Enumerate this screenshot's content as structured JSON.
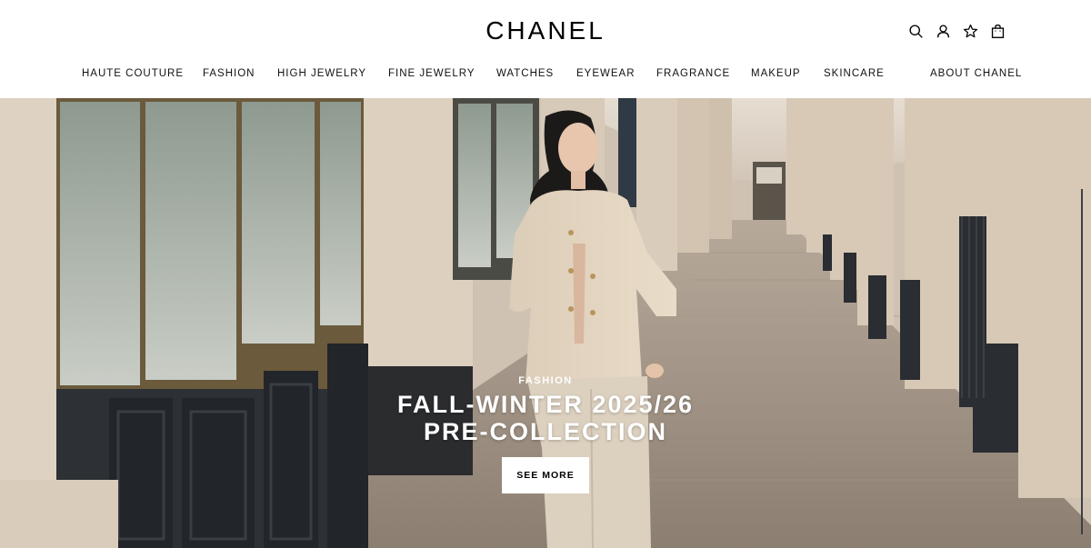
{
  "brand": {
    "logo_text": "CHANEL"
  },
  "header_icons": [
    {
      "name": "search-icon"
    },
    {
      "name": "account-icon"
    },
    {
      "name": "wishlist-star-icon"
    },
    {
      "name": "shopping-bag-icon"
    }
  ],
  "nav": {
    "items": [
      "HAUTE COUTURE",
      "FASHION",
      "HIGH JEWELRY",
      "FINE JEWELRY",
      "WATCHES",
      "EYEWEAR",
      "FRAGRANCE",
      "MAKEUP",
      "SKINCARE",
      "ABOUT CHANEL"
    ]
  },
  "hero": {
    "eyebrow": "FASHION",
    "title_line1": "FALL-WINTER 2025/26",
    "title_line2": "PRE-COLLECTION",
    "cta_label": "SEE MORE"
  }
}
